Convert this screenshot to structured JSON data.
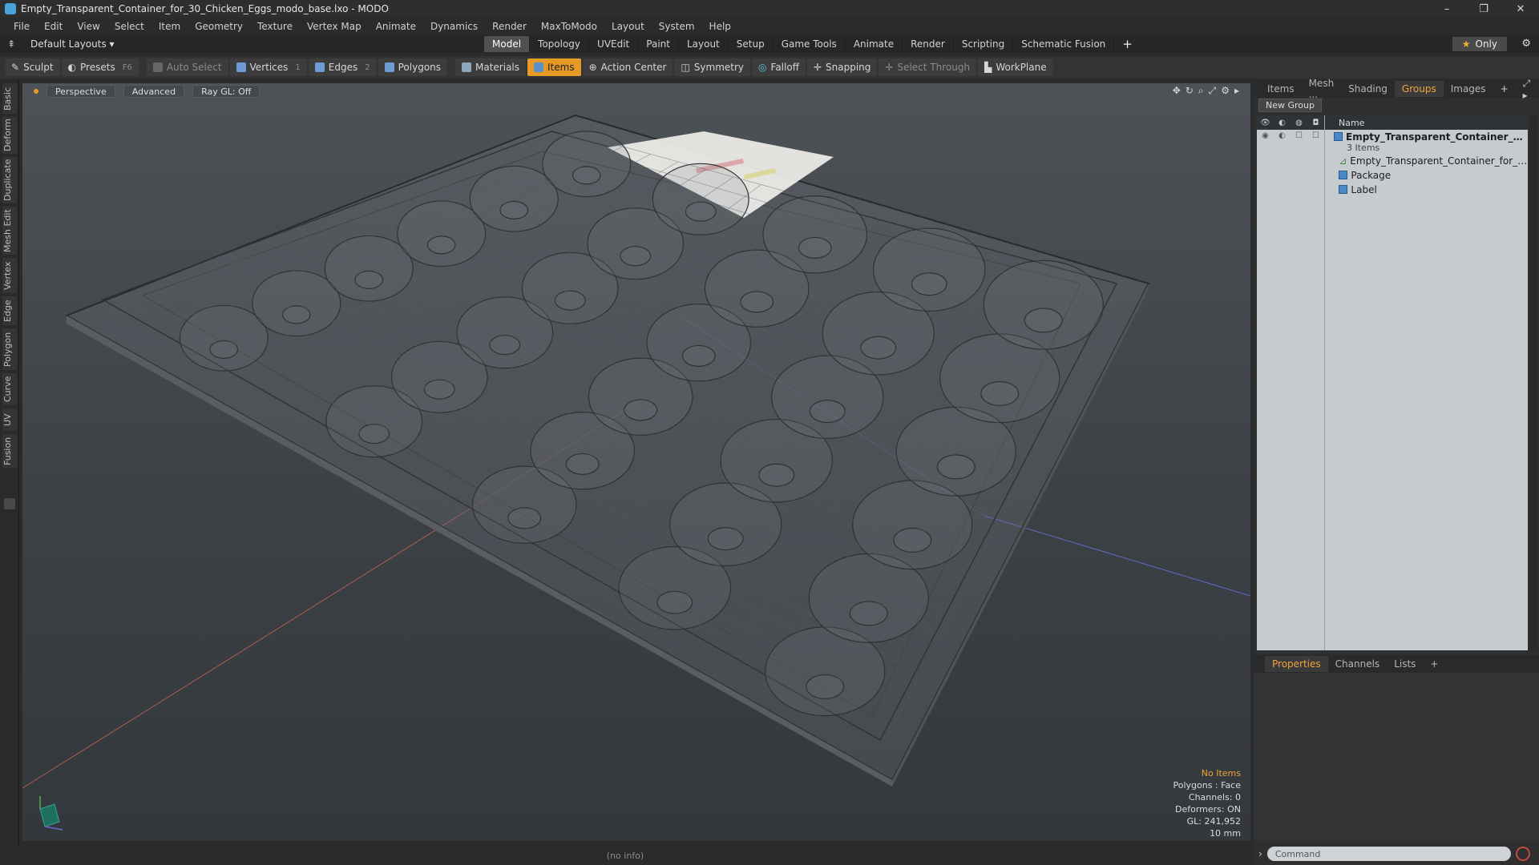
{
  "window": {
    "title": "Empty_Transparent_Container_for_30_Chicken_Eggs_modo_base.lxo - MODO",
    "controls": [
      "–",
      "❐",
      "✕"
    ]
  },
  "menu": [
    "File",
    "Edit",
    "View",
    "Select",
    "Item",
    "Geometry",
    "Texture",
    "Vertex Map",
    "Animate",
    "Dynamics",
    "Render",
    "MaxToModo",
    "Layout",
    "System",
    "Help"
  ],
  "layoutbar": {
    "layout_select": "Default Layouts ▾",
    "tabs": [
      "Model",
      "Topology",
      "UVEdit",
      "Paint",
      "Layout",
      "Setup",
      "Game Tools",
      "Animate",
      "Render",
      "Scripting",
      "Schematic Fusion"
    ],
    "active_tab": "Model",
    "add": "+",
    "only_label": "Only"
  },
  "toolbar": {
    "sculpt": "Sculpt",
    "presets": "Presets",
    "presets_key": "F6",
    "auto_select": "Auto Select",
    "vertices": "Vertices",
    "vertices_key": "1",
    "edges": "Edges",
    "edges_key": "2",
    "polygons": "Polygons",
    "materials": "Materials",
    "items": "Items",
    "action_center": "Action Center",
    "symmetry": "Symmetry",
    "falloff": "Falloff",
    "snapping": "Snapping",
    "select_through": "Select Through",
    "workplane": "WorkPlane"
  },
  "left_tabs": [
    "Basic",
    "Deform",
    "Duplicate",
    "Mesh Edit",
    "Vertex",
    "Edge",
    "Polygon",
    "Curve",
    "UV",
    "Fusion"
  ],
  "viewport": {
    "view": "Perspective",
    "shading": "Advanced",
    "raygl": "Ray GL: Off",
    "stats": {
      "selection": "No Items",
      "polygons": "Polygons : Face",
      "channels": "Channels: 0",
      "deformers": "Deformers: ON",
      "gl": "GL: 241,952",
      "scale": "10 mm"
    }
  },
  "status": "(no info)",
  "right_panel": {
    "tabs": [
      "Items",
      "Mesh ...",
      "Shading",
      "Groups",
      "Images"
    ],
    "active_tab": "Groups",
    "new_group": "New Group",
    "column_name": "Name",
    "rows": [
      {
        "label": "Empty_Transparent_Container_fo...",
        "sub": "3 Items"
      },
      {
        "label": "Empty_Transparent_Container_for_3 ..."
      },
      {
        "label": "Package"
      },
      {
        "label": "Label"
      }
    ],
    "bottom_tabs": [
      "Properties",
      "Channels",
      "Lists"
    ],
    "bottom_active": "Properties",
    "command_placeholder": "Command"
  },
  "colors": {
    "accent": "#e49a25",
    "tab_active_text": "#f0a33a",
    "list_bg": "#c6cbd0"
  }
}
